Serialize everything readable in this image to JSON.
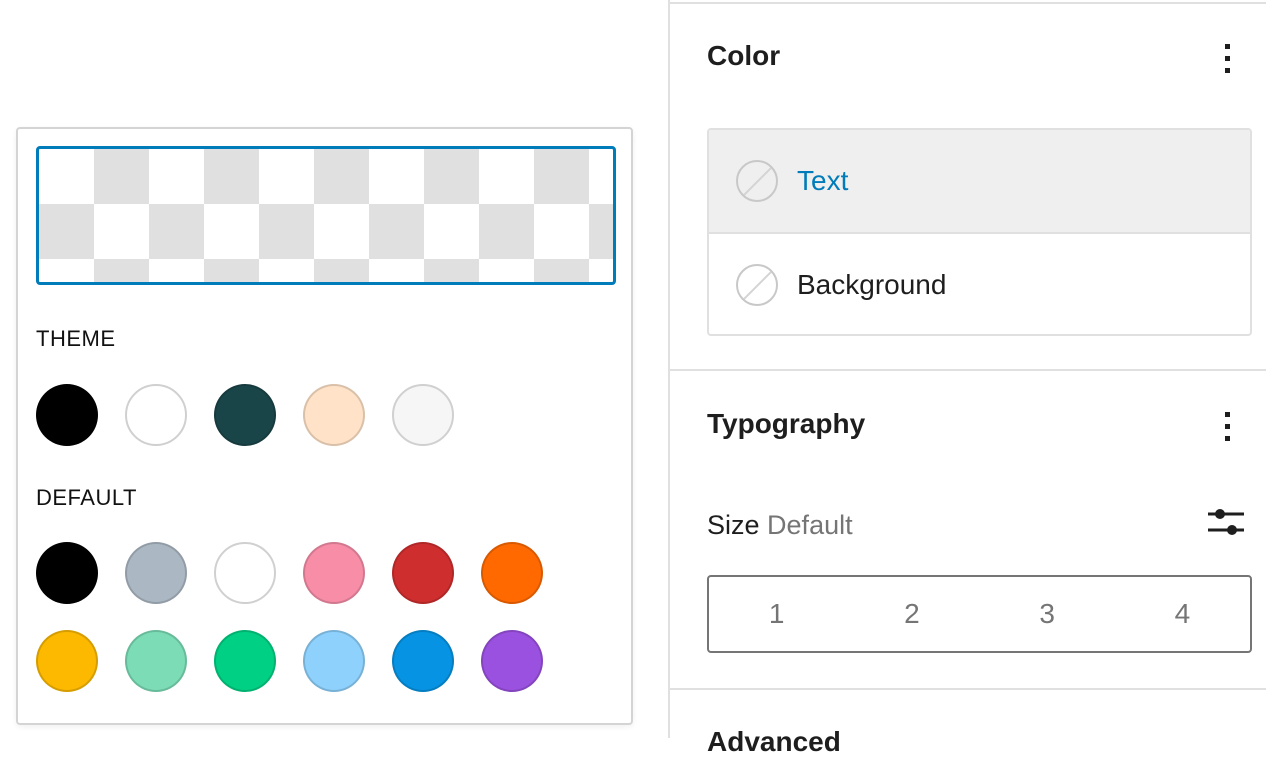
{
  "color_picker": {
    "preview_value": "transparent",
    "theme_label": "THEME",
    "default_label": "DEFAULT",
    "theme_colors": [
      {
        "name": "Black",
        "hex": "#000000"
      },
      {
        "name": "White",
        "hex": "#ffffff"
      },
      {
        "name": "Dark Teal",
        "hex": "#1a4548"
      },
      {
        "name": "Peach",
        "hex": "#ffe2c7"
      },
      {
        "name": "Light Gray",
        "hex": "#f6f6f6"
      }
    ],
    "default_colors": [
      {
        "name": "Black",
        "hex": "#000000"
      },
      {
        "name": "Cyan bluish gray",
        "hex": "#abb8c3"
      },
      {
        "name": "White",
        "hex": "#ffffff"
      },
      {
        "name": "Pale pink",
        "hex": "#f78da7"
      },
      {
        "name": "Vivid red",
        "hex": "#cf2e2e"
      },
      {
        "name": "Luminous vivid orange",
        "hex": "#ff6900"
      },
      {
        "name": "Luminous vivid amber",
        "hex": "#fcb900"
      },
      {
        "name": "Light green cyan",
        "hex": "#7bdcb5"
      },
      {
        "name": "Vivid green cyan",
        "hex": "#00d084"
      },
      {
        "name": "Pale cyan blue",
        "hex": "#8ed1fc"
      },
      {
        "name": "Vivid cyan blue",
        "hex": "#0693e3"
      },
      {
        "name": "Vivid purple",
        "hex": "#9b51e0"
      }
    ]
  },
  "sidebar": {
    "color_panel": {
      "title": "Color",
      "items": [
        {
          "label": "Text",
          "active": true
        },
        {
          "label": "Background",
          "active": false
        }
      ]
    },
    "typography_panel": {
      "title": "Typography",
      "size_label": "Size",
      "size_value": "Default",
      "size_options": [
        "1",
        "2",
        "3",
        "4"
      ]
    },
    "advanced_panel": {
      "title": "Advanced"
    }
  },
  "colors": {
    "accent": "#007cba",
    "border": "#e0e0e0",
    "muted_text": "#757575"
  }
}
